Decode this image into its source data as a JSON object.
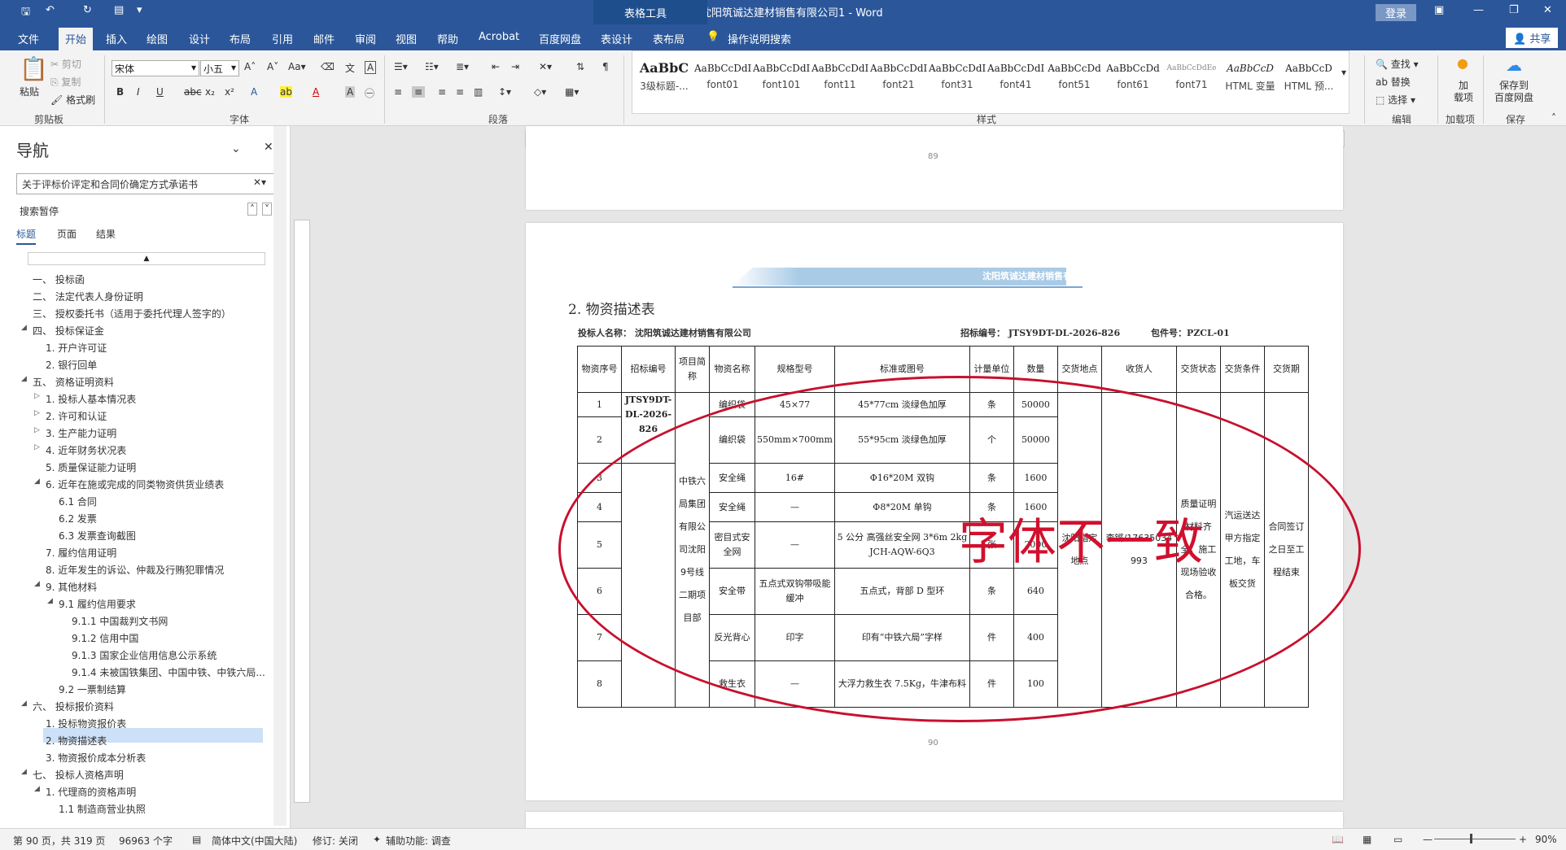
{
  "titlebar": {
    "doc_title": "沈阳筑诚达建材销售有限公司1  -  Word",
    "context_tools": "表格工具",
    "login": "登录"
  },
  "tabs": [
    "文件",
    "开始",
    "插入",
    "绘图",
    "设计",
    "布局",
    "引用",
    "邮件",
    "审阅",
    "视图",
    "帮助",
    "Acrobat",
    "百度网盘",
    "表设计",
    "表布局"
  ],
  "tell_me": "操作说明搜索",
  "share": "共享",
  "ribbon": {
    "clipboard": {
      "paste": "粘贴",
      "cut": "剪切",
      "copy": "复制",
      "format_painter": "格式刷",
      "label": "剪贴板"
    },
    "font": {
      "name": "宋体",
      "size": "小五",
      "label": "字体"
    },
    "paragraph": {
      "label": "段落"
    },
    "styles": {
      "label": "样式",
      "items": [
        {
          "preview": "AaBbC",
          "name": "3级标题-..."
        },
        {
          "preview": "AaBbCcDdI",
          "name": "font01"
        },
        {
          "preview": "AaBbCcDdI",
          "name": "font101"
        },
        {
          "preview": "AaBbCcDdI",
          "name": "font11"
        },
        {
          "preview": "AaBbCcDdI",
          "name": "font21"
        },
        {
          "preview": "AaBbCcDdI",
          "name": "font31"
        },
        {
          "preview": "AaBbCcDdI",
          "name": "font41"
        },
        {
          "preview": "AaBbCcDd",
          "name": "font51"
        },
        {
          "preview": "AaBbCcDd",
          "name": "font61"
        },
        {
          "preview": "AaBbCcDdEe",
          "name": "font71"
        },
        {
          "preview": "AaBbCcD",
          "name": "HTML 变量"
        },
        {
          "preview": "AaBbCcD",
          "name": "HTML 预..."
        }
      ]
    },
    "editing": {
      "find": "查找",
      "replace": "替换",
      "select": "选择",
      "label": "编辑"
    },
    "addins": {
      "name": "加\n载项",
      "label": "加载项"
    },
    "save": {
      "name": "保存到\n百度网盘",
      "label": "保存"
    }
  },
  "nav": {
    "title": "导航",
    "search_value": "关于评标价评定和合同价确定方式承诺书",
    "paused": "搜索暂停",
    "subtabs": [
      "标题",
      "页面",
      "结果"
    ],
    "items": [
      "一、 投标函",
      "二、 法定代表人身份证明",
      "三、 授权委托书（适用于委托代理人签字的）",
      "四、 投标保证金",
      "1. 开户许可证",
      "2. 银行回单",
      "五、 资格证明资料",
      "1. 投标人基本情况表",
      "2. 许可和认证",
      "3. 生产能力证明",
      "4. 近年财务状况表",
      "5. 质量保证能力证明",
      "6. 近年在施或完成的同类物资供货业绩表",
      "6.1 合同",
      "6.2 发票",
      "6.3 发票查询截图",
      "7. 履约信用证明",
      "8. 近年发生的诉讼、仲裁及行贿犯罪情况",
      "9. 其他材料",
      "9.1 履约信用要求",
      "9.1.1 中国裁判文书网",
      "9.1.2 信用中国",
      "9.1.3 国家企业信用信息公示系统",
      "9.1.4 未被国铁集团、中国中铁、中铁六局...",
      "9.2 一票制结算",
      "六、 投标报价资料",
      "1. 投标物资报价表",
      "2. 物资描述表",
      "3. 物资报价成本分析表",
      "七、 投标人资格声明",
      "1. 代理商的资格声明",
      "1.1 制造商营业执照"
    ]
  },
  "ruler_numbers": [
    "4",
    "2",
    "",
    "2",
    "4",
    "6",
    "8",
    "10",
    "12",
    "14",
    "16",
    "18",
    "20",
    "22",
    "24",
    "26",
    "28",
    "30",
    "32",
    "34",
    "36",
    "38",
    "40",
    "42",
    "44",
    "46",
    "48",
    "50",
    "52",
    "54",
    "56",
    "58",
    "60",
    "62",
    "64",
    "66",
    "68",
    "70"
  ],
  "document": {
    "page_top_number": "89",
    "page_bottom_number": "90",
    "header_company": "沈阳筑诚达建材销售有限公司",
    "heading": "2.  物资描述表",
    "bidder_label": "投标人名称：  沈阳筑诚达建材销售有限公司",
    "bid_no": "招标编号：  JTSY9DT-DL-2026-826",
    "package_no": "包件号：PZCL-01",
    "table_headers": [
      "物资序号",
      "招标编号",
      "项目简称",
      "物资名称",
      "规格型号",
      "标准或图号",
      "计量单位",
      "数量",
      "交货地点",
      "收货人",
      "交货状态",
      "交货条件",
      "交货期"
    ],
    "merged": {
      "bid_no_cell": "JTSY9DT-DL-2026-826",
      "project_cell": "中铁六局集团有限公司沈阳9号线二期项目部",
      "delivery_place": "沈阳指定地点",
      "receiver": "李锵/17635034993",
      "delivery_state": "质量证明材料齐全，施工现场验收合格。",
      "delivery_terms": "汽运送达甲方指定工地，车板交货",
      "delivery_period": "合同签订之日至工程结束"
    },
    "rows": [
      {
        "no": "1",
        "name": "编织袋",
        "spec": "45×77",
        "std": "45*77cm 淡绿色加厚",
        "unit": "条",
        "qty": "50000"
      },
      {
        "no": "2",
        "name": "编织袋",
        "spec": "550mm×700mm",
        "std": "55*95cm 淡绿色加厚",
        "unit": "个",
        "qty": "50000"
      },
      {
        "no": "3",
        "name": "安全绳",
        "spec": "16#",
        "std": "Φ16*20M 双钩",
        "unit": "条",
        "qty": "1600"
      },
      {
        "no": "4",
        "name": "安全绳",
        "spec": "—",
        "std": "Φ8*20M 单钩",
        "unit": "条",
        "qty": "1600"
      },
      {
        "no": "5",
        "name": "密目式安全网",
        "spec": "—",
        "std": "5 公分 高强丝安全网 3*6m 2kg JCH-AQW-6Q3",
        "unit": "张",
        "qty": "2000"
      },
      {
        "no": "6",
        "name": "安全带",
        "spec": "五点式双钩带吸能缓冲",
        "std": "五点式，背部 D 型环",
        "unit": "条",
        "qty": "640"
      },
      {
        "no": "7",
        "name": "反光背心",
        "spec": "印字",
        "std": "印有“中铁六局”字样",
        "unit": "件",
        "qty": "400"
      },
      {
        "no": "8",
        "name": "救生衣",
        "spec": "—",
        "std": "大浮力救生衣 7.5Kg，牛津布料",
        "unit": "件",
        "qty": "100"
      }
    ]
  },
  "annotation": "字体不一致",
  "statusbar": {
    "page": "第 90 页，共 319 页",
    "words": "96963 个字",
    "language": "简体中文(中国大陆)",
    "track": "修订: 关闭",
    "accessibility": "辅助功能: 调查",
    "zoom": "90%"
  }
}
